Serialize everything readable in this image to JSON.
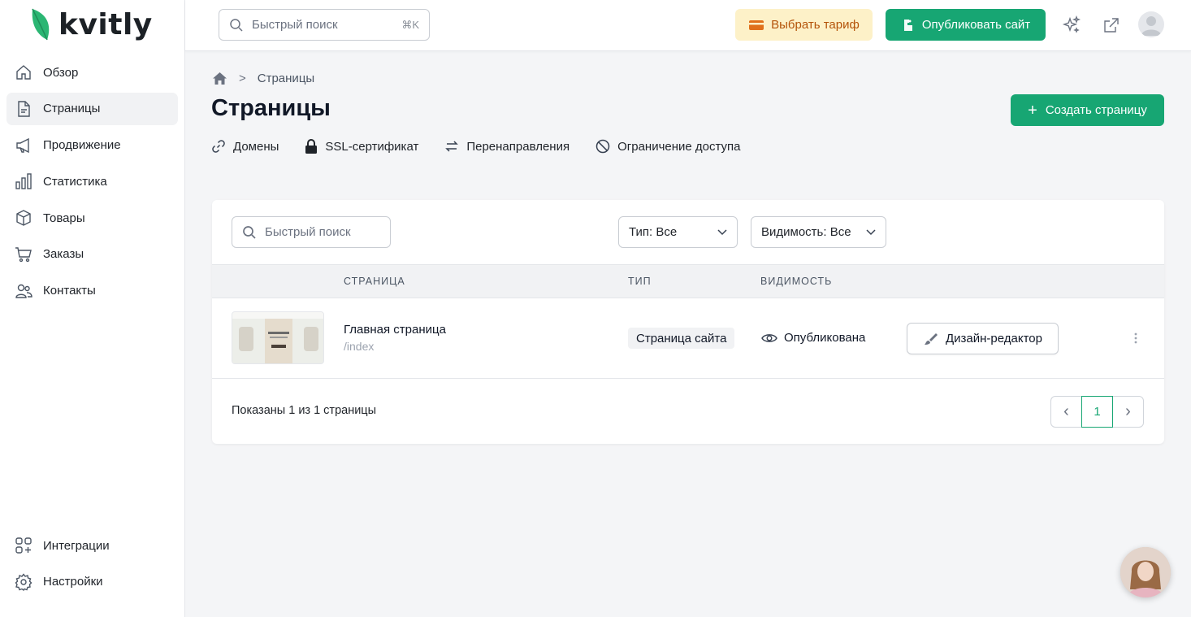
{
  "app": {
    "logo_text": "kvitly",
    "brand_color": "#17a673",
    "logo_leaf_color": "#2bb673"
  },
  "sidebar": {
    "items": [
      {
        "label": "Обзор",
        "icon": "home-icon"
      },
      {
        "label": "Страницы",
        "icon": "page-icon",
        "active": true
      },
      {
        "label": "Продвижение",
        "icon": "megaphone-icon"
      },
      {
        "label": "Статистика",
        "icon": "bar-chart-icon"
      },
      {
        "label": "Товары",
        "icon": "box-icon"
      },
      {
        "label": "Заказы",
        "icon": "cart-icon"
      },
      {
        "label": "Контакты",
        "icon": "users-icon"
      }
    ],
    "bottom_items": [
      {
        "label": "Интеграции",
        "icon": "grid-plus-icon"
      },
      {
        "label": "Настройки",
        "icon": "gear-icon"
      }
    ]
  },
  "topbar": {
    "search_placeholder": "Быстрый поиск",
    "search_shortcut": "⌘K",
    "tariff_label": "Выбрать тариф",
    "publish_label": "Опубликовать сайт",
    "icons": [
      "sparkles-icon",
      "external-link-icon",
      "user-avatar"
    ]
  },
  "page": {
    "breadcrumb": {
      "home_icon": "home-icon",
      "separator": ">",
      "current": "Страницы"
    },
    "title": "Страницы",
    "create_label": "Создать страницу",
    "subnav": [
      {
        "label": "Домены",
        "icon": "link-icon"
      },
      {
        "label": "SSL-сертификат",
        "icon": "lock-icon"
      },
      {
        "label": "Перенаправления",
        "icon": "arrows-swap-icon"
      },
      {
        "label": "Ограничение доступа",
        "icon": "ban-icon"
      }
    ]
  },
  "table": {
    "search_placeholder": "Быстрый поиск",
    "filter_type": "Тип: Все",
    "filter_visibility": "Видимость: Все",
    "columns": [
      "СТРАНИЦА",
      "ТИП",
      "ВИДИМОСТЬ"
    ],
    "rows": [
      {
        "title": "Главная страница",
        "path": "/index",
        "type": "Страница сайта",
        "visibility": "Опубликована",
        "action_label": "Дизайн-редактор"
      }
    ],
    "footer": "Показаны 1 из 1 страницы",
    "pagination": {
      "current": "1",
      "prev": "‹",
      "next": "›"
    }
  }
}
